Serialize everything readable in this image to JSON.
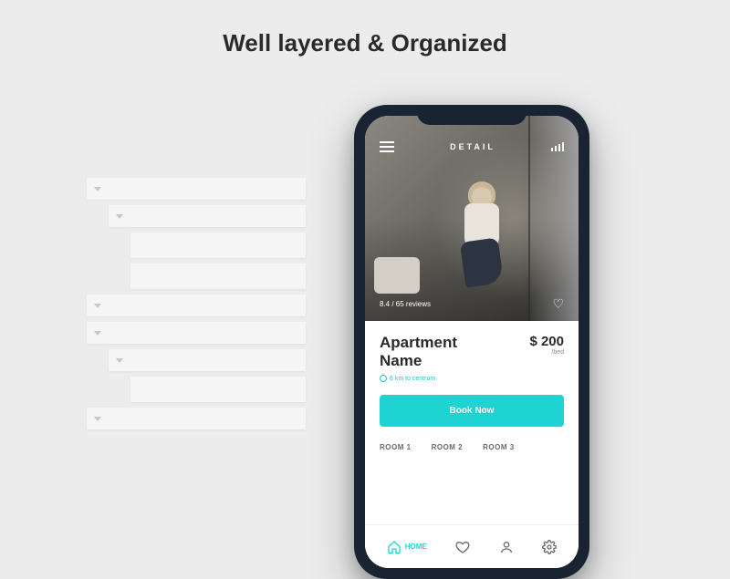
{
  "heading": "Well layered & Organized",
  "phone": {
    "header": {
      "title": "DETAIL"
    },
    "hero": {
      "rating_reviews": "8.4 / 65 reviews"
    },
    "listing": {
      "name": "Apartment\nName",
      "price_value": "$ 200",
      "price_unit": "/bed",
      "distance": "6 km to centrum",
      "book_label": "Book Now"
    },
    "rooms": [
      "ROOM 1",
      "ROOM 2",
      "ROOM 3"
    ],
    "tabs": {
      "home": "HOME"
    }
  }
}
